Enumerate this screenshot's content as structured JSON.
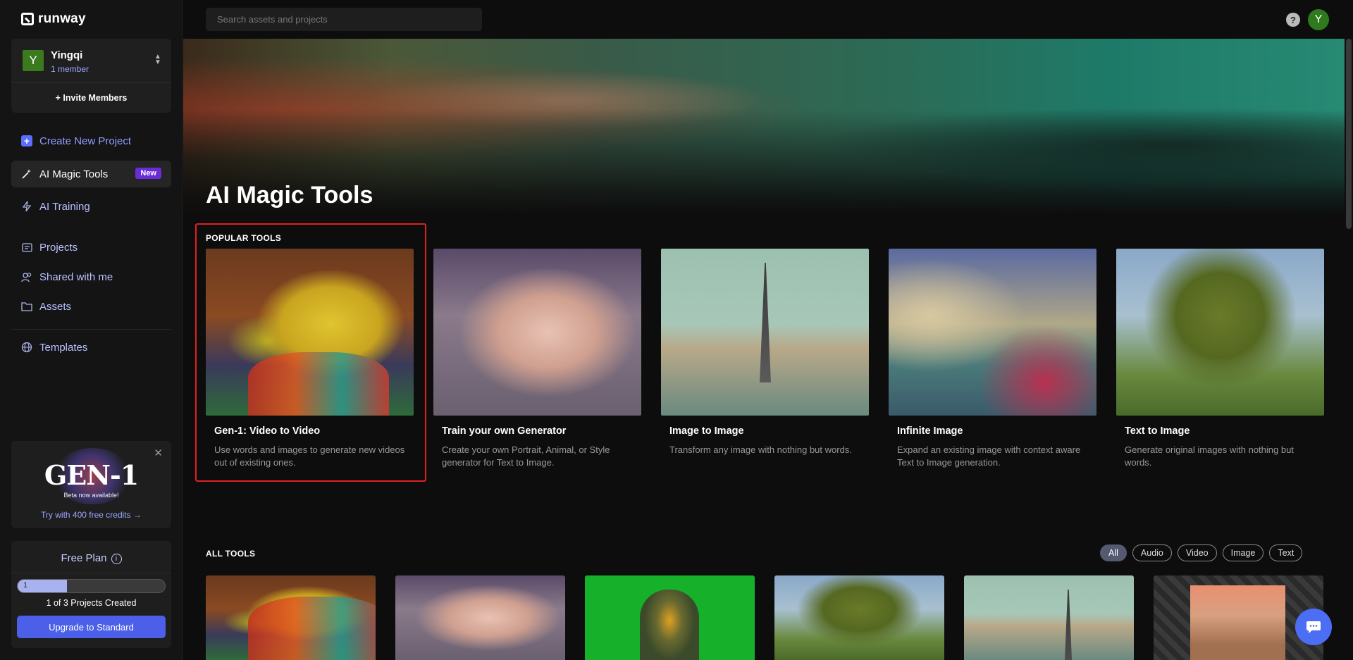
{
  "app": {
    "logo_text": "runway"
  },
  "sidebar": {
    "workspace": {
      "avatar_letter": "Y",
      "name": "Yingqi",
      "members": "1 member",
      "invite_label": "+ Invite Members"
    },
    "create_project": "Create New Project",
    "items": [
      {
        "label": "AI Magic Tools",
        "badge": "New",
        "icon": "magic-wand-icon"
      },
      {
        "label": "AI Training",
        "icon": "lightning-icon"
      },
      {
        "label": "Projects",
        "icon": "projects-icon"
      },
      {
        "label": "Shared with me",
        "icon": "users-icon"
      },
      {
        "label": "Assets",
        "icon": "folder-icon"
      },
      {
        "label": "Templates",
        "icon": "globe-icon"
      }
    ],
    "promo": {
      "title": "GEN-1",
      "subtitle": "Beta now available!",
      "link": "Try with 400 free credits →"
    },
    "plan": {
      "title": "Free Plan",
      "progress_value": "1",
      "progress_fraction": 0.333,
      "count_text": "1 of 3 Projects Created",
      "upgrade_label": "Upgrade to Standard"
    }
  },
  "topbar": {
    "search_placeholder": "Search assets and projects",
    "help_label": "?",
    "avatar_letter": "Y"
  },
  "hero": {
    "title": "AI Magic Tools"
  },
  "popular": {
    "label": "POPULAR TOOLS",
    "tools": [
      {
        "title": "Gen-1: Video to Video",
        "desc": "Use words and images to generate new videos out of existing ones."
      },
      {
        "title": "Train your own Generator",
        "desc": "Create your own Portrait, Animal, or Style generator for Text to Image."
      },
      {
        "title": "Image to Image",
        "desc": "Transform any image with nothing but words."
      },
      {
        "title": "Infinite Image",
        "desc": "Expand an existing image with context aware Text to Image generation."
      },
      {
        "title": "Text to Image",
        "desc": "Generate original images with nothing but words."
      }
    ]
  },
  "all_tools": {
    "label": "ALL TOOLS",
    "filters": [
      "All",
      "Audio",
      "Video",
      "Image",
      "Text"
    ],
    "active_filter": "All"
  },
  "colors": {
    "accent": "#4c5fe8",
    "badge": "#6a2bd9",
    "highlight": "#e02020",
    "avatar": "#3c7a1e"
  }
}
